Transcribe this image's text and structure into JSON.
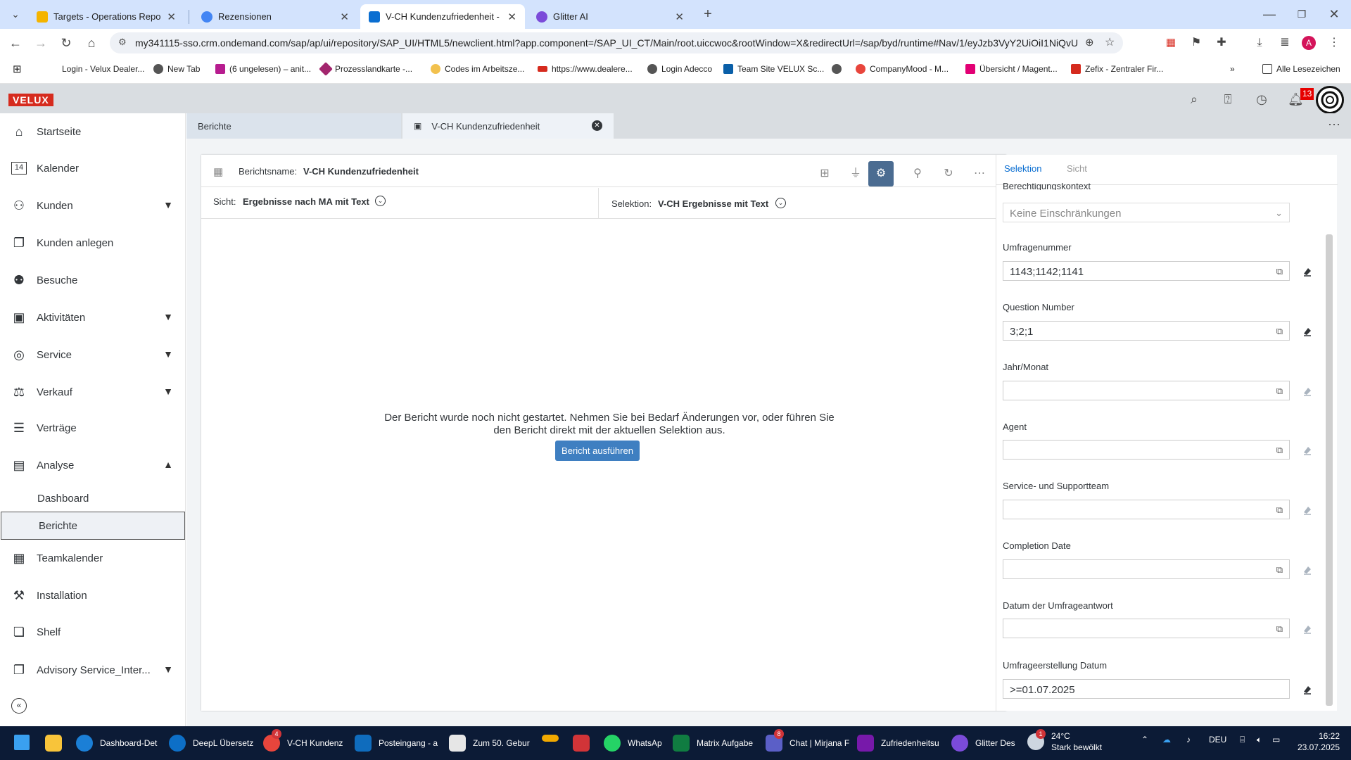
{
  "browser": {
    "tabs": [
      {
        "title": "Targets - Operations Report",
        "favicon_color": "#f4b400"
      },
      {
        "title": "Rezensionen",
        "favicon_color": "#4285f4"
      },
      {
        "title": "V-CH Kundenzufriedenheit - SAP",
        "favicon_color": "#0a6ed1"
      },
      {
        "title": "Glitter AI",
        "favicon_color": "#7b4bd9"
      }
    ],
    "new_tab_label": "+",
    "url": "my341115-sso.crm.ondemand.com/sap/ap/ui/repository/SAP_UI/HTML5/newclient.html?app.component=/SAP_UI_CT/Main/root.uiccwoc&rootWindow=X&redirectUrl=/sap/byd/runtime#Nav/1/eyJzb3VyY2UiOiI1NiQvU0...",
    "profile_initial": "A",
    "bookmarks": [
      "Login - Velux Dealer...",
      "New Tab",
      "(6 ungelesen) – anit...",
      "Prozesslandkarte -...",
      "Codes im Arbeitsze...",
      "https://www.dealere...",
      "Login Adecco",
      "Team Site VELUX Sc...",
      "",
      "CompanyMood - M...",
      "Übersicht / Magent...",
      "Zefix - Zentraler Fir..."
    ],
    "all_bookmarks_label": "Alle Lesezeichen",
    "overflow_label": "»"
  },
  "shell": {
    "brand": "VELUX",
    "notification_count": "13"
  },
  "sidebar": {
    "items": [
      {
        "label": "Startseite",
        "icon": "home-icon"
      },
      {
        "label": "Kalender",
        "icon": "calendar-icon"
      },
      {
        "label": "Kunden",
        "icon": "customers-icon",
        "expandable": true
      },
      {
        "label": "Kunden anlegen",
        "icon": "copy-icon"
      },
      {
        "label": "Besuche",
        "icon": "visits-icon"
      },
      {
        "label": "Aktivitäten",
        "icon": "activities-icon",
        "expandable": true
      },
      {
        "label": "Service",
        "icon": "service-icon",
        "expandable": true
      },
      {
        "label": "Verkauf",
        "icon": "sales-icon",
        "expandable": true
      },
      {
        "label": "Verträge",
        "icon": "contracts-icon"
      },
      {
        "label": "Analyse",
        "icon": "analytics-icon",
        "expanded": true
      }
    ],
    "analyse_subitems": [
      "Dashboard",
      "Berichte"
    ],
    "bottom_items": [
      {
        "label": "Teamkalender",
        "icon": "team-calendar-icon"
      },
      {
        "label": "Installation",
        "icon": "installation-icon"
      },
      {
        "label": "Shelf",
        "icon": "shelf-icon"
      },
      {
        "label": "Advisory Service_Inter...",
        "icon": "advisory-icon",
        "expandable": true
      }
    ]
  },
  "content_tabs": [
    {
      "label": "Berichte"
    },
    {
      "label": "V-CH Kundenzufriedenheit"
    }
  ],
  "report": {
    "name_label": "Berichtsname:",
    "name_value": "V-CH Kundenzufriedenheit",
    "view_label": "Sicht:",
    "view_value": "Ergebnisse nach MA mit Text",
    "selection_label": "Selektion:",
    "selection_value": "V-CH Ergebnisse mit Text",
    "message_line1": "Der Bericht wurde noch nicht gestartet. Nehmen Sie bei Bedarf Änderungen vor, oder führen Sie",
    "message_line2": "den Bericht direkt mit der aktuellen Selektion aus.",
    "run_button": "Bericht ausführen"
  },
  "panel": {
    "tabs": [
      "Selektion",
      "Sicht"
    ],
    "context_label": "Berechtigungskontext",
    "context_value": "Keine Einschränkungen",
    "fields": [
      {
        "label": "Umfragenummer",
        "value": "1143;1142;1141"
      },
      {
        "label": "Question Number",
        "value": "3;2;1"
      },
      {
        "label": "Jahr/Monat",
        "value": ""
      },
      {
        "label": "Agent",
        "value": ""
      },
      {
        "label": "Service- und Supportteam",
        "value": ""
      },
      {
        "label": "Completion Date",
        "value": ""
      },
      {
        "label": "Datum der Umfrageantwort",
        "value": ""
      },
      {
        "label": "Umfrageerstellung Datum",
        "value": ">=01.07.2025"
      }
    ]
  },
  "taskbar": {
    "apps": [
      {
        "label": "Dashboard-Det",
        "color": "#1b7fd6"
      },
      {
        "label": "DeepL Übersetz",
        "color": "#0d6fc7"
      },
      {
        "label": "V-CH Kundenz",
        "color": "#e8453c"
      },
      {
        "label": "Posteingang - a",
        "color": "#0f6cbd"
      },
      {
        "label": "Zum 50. Gebur",
        "color": "#e6e6e6"
      },
      {
        "label": "",
        "color": "#f2a900"
      },
      {
        "label": "",
        "color": "#d13438"
      },
      {
        "label": "WhatsAp",
        "color": "#25d366"
      },
      {
        "label": "Matrix Aufgabe",
        "color": "#107c41"
      },
      {
        "label": "Chat | Mirjana F",
        "color": "#5b5fc7"
      },
      {
        "label": "Zufriedenheitsu",
        "color": "#7719aa"
      },
      {
        "label": "Glitter Des",
        "color": "#7b4bd9"
      }
    ],
    "badges": {
      "chrome": "4",
      "teams": "8",
      "weather": "1"
    },
    "weather_temp": "24°C",
    "weather_text": "Stark bewölkt",
    "language": "DEU",
    "time": "16:22",
    "date": "23.07.2025"
  }
}
